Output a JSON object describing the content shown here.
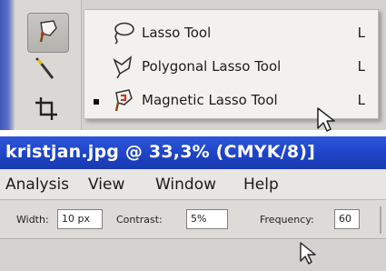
{
  "flyout": {
    "items": [
      {
        "label": "Lasso Tool",
        "shortcut": "L",
        "icon": "lasso-icon",
        "selected": false
      },
      {
        "label": "Polygonal Lasso Tool",
        "shortcut": "L",
        "icon": "polygonal-lasso-icon",
        "selected": false
      },
      {
        "label": "Magnetic Lasso Tool",
        "shortcut": "L",
        "icon": "magnetic-lasso-icon",
        "selected": true
      }
    ]
  },
  "toolbox": {
    "tools": [
      "lasso-tool-icon",
      "magic-wand-icon",
      "crop-icon"
    ]
  },
  "titlebar": {
    "title": "kristjan.jpg @ 33,3% (CMYK/8)]"
  },
  "menubar": {
    "items": [
      "Analysis",
      "View",
      "Window",
      "Help"
    ]
  },
  "options": {
    "width_label": "Width:",
    "width_value": "10 px",
    "contrast_label": "Contrast:",
    "contrast_value": "5%",
    "frequency_label": "Frequency:",
    "frequency_value": "60"
  },
  "colors": {
    "titlebar": "#1e43c6",
    "panel": "#d9d8d4",
    "flyout": "#f2f1ee"
  }
}
